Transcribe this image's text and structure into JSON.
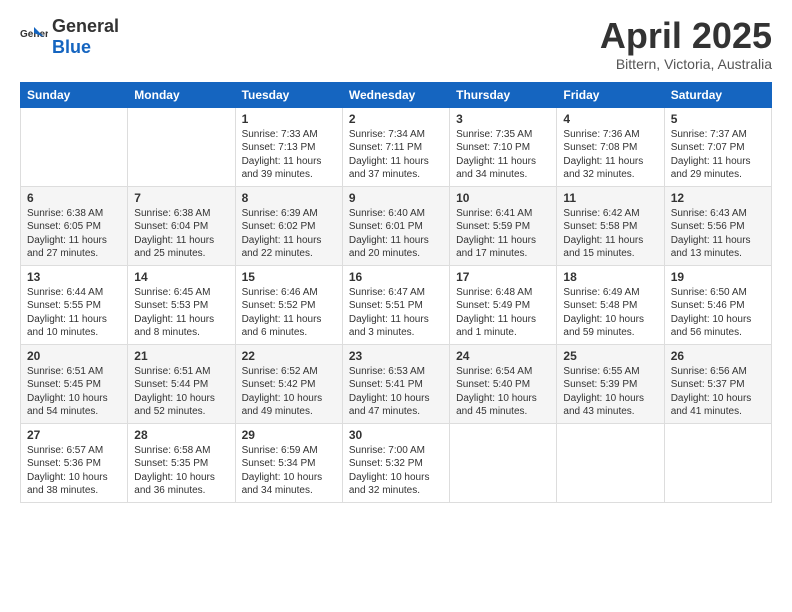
{
  "logo": {
    "general": "General",
    "blue": "Blue"
  },
  "header": {
    "title": "April 2025",
    "subtitle": "Bittern, Victoria, Australia"
  },
  "days_of_week": [
    "Sunday",
    "Monday",
    "Tuesday",
    "Wednesday",
    "Thursday",
    "Friday",
    "Saturday"
  ],
  "weeks": [
    [
      {
        "day": "",
        "info": ""
      },
      {
        "day": "",
        "info": ""
      },
      {
        "day": "1",
        "info": "Sunrise: 7:33 AM\nSunset: 7:13 PM\nDaylight: 11 hours and 39 minutes."
      },
      {
        "day": "2",
        "info": "Sunrise: 7:34 AM\nSunset: 7:11 PM\nDaylight: 11 hours and 37 minutes."
      },
      {
        "day": "3",
        "info": "Sunrise: 7:35 AM\nSunset: 7:10 PM\nDaylight: 11 hours and 34 minutes."
      },
      {
        "day": "4",
        "info": "Sunrise: 7:36 AM\nSunset: 7:08 PM\nDaylight: 11 hours and 32 minutes."
      },
      {
        "day": "5",
        "info": "Sunrise: 7:37 AM\nSunset: 7:07 PM\nDaylight: 11 hours and 29 minutes."
      }
    ],
    [
      {
        "day": "6",
        "info": "Sunrise: 6:38 AM\nSunset: 6:05 PM\nDaylight: 11 hours and 27 minutes."
      },
      {
        "day": "7",
        "info": "Sunrise: 6:38 AM\nSunset: 6:04 PM\nDaylight: 11 hours and 25 minutes."
      },
      {
        "day": "8",
        "info": "Sunrise: 6:39 AM\nSunset: 6:02 PM\nDaylight: 11 hours and 22 minutes."
      },
      {
        "day": "9",
        "info": "Sunrise: 6:40 AM\nSunset: 6:01 PM\nDaylight: 11 hours and 20 minutes."
      },
      {
        "day": "10",
        "info": "Sunrise: 6:41 AM\nSunset: 5:59 PM\nDaylight: 11 hours and 17 minutes."
      },
      {
        "day": "11",
        "info": "Sunrise: 6:42 AM\nSunset: 5:58 PM\nDaylight: 11 hours and 15 minutes."
      },
      {
        "day": "12",
        "info": "Sunrise: 6:43 AM\nSunset: 5:56 PM\nDaylight: 11 hours and 13 minutes."
      }
    ],
    [
      {
        "day": "13",
        "info": "Sunrise: 6:44 AM\nSunset: 5:55 PM\nDaylight: 11 hours and 10 minutes."
      },
      {
        "day": "14",
        "info": "Sunrise: 6:45 AM\nSunset: 5:53 PM\nDaylight: 11 hours and 8 minutes."
      },
      {
        "day": "15",
        "info": "Sunrise: 6:46 AM\nSunset: 5:52 PM\nDaylight: 11 hours and 6 minutes."
      },
      {
        "day": "16",
        "info": "Sunrise: 6:47 AM\nSunset: 5:51 PM\nDaylight: 11 hours and 3 minutes."
      },
      {
        "day": "17",
        "info": "Sunrise: 6:48 AM\nSunset: 5:49 PM\nDaylight: 11 hours and 1 minute."
      },
      {
        "day": "18",
        "info": "Sunrise: 6:49 AM\nSunset: 5:48 PM\nDaylight: 10 hours and 59 minutes."
      },
      {
        "day": "19",
        "info": "Sunrise: 6:50 AM\nSunset: 5:46 PM\nDaylight: 10 hours and 56 minutes."
      }
    ],
    [
      {
        "day": "20",
        "info": "Sunrise: 6:51 AM\nSunset: 5:45 PM\nDaylight: 10 hours and 54 minutes."
      },
      {
        "day": "21",
        "info": "Sunrise: 6:51 AM\nSunset: 5:44 PM\nDaylight: 10 hours and 52 minutes."
      },
      {
        "day": "22",
        "info": "Sunrise: 6:52 AM\nSunset: 5:42 PM\nDaylight: 10 hours and 49 minutes."
      },
      {
        "day": "23",
        "info": "Sunrise: 6:53 AM\nSunset: 5:41 PM\nDaylight: 10 hours and 47 minutes."
      },
      {
        "day": "24",
        "info": "Sunrise: 6:54 AM\nSunset: 5:40 PM\nDaylight: 10 hours and 45 minutes."
      },
      {
        "day": "25",
        "info": "Sunrise: 6:55 AM\nSunset: 5:39 PM\nDaylight: 10 hours and 43 minutes."
      },
      {
        "day": "26",
        "info": "Sunrise: 6:56 AM\nSunset: 5:37 PM\nDaylight: 10 hours and 41 minutes."
      }
    ],
    [
      {
        "day": "27",
        "info": "Sunrise: 6:57 AM\nSunset: 5:36 PM\nDaylight: 10 hours and 38 minutes."
      },
      {
        "day": "28",
        "info": "Sunrise: 6:58 AM\nSunset: 5:35 PM\nDaylight: 10 hours and 36 minutes."
      },
      {
        "day": "29",
        "info": "Sunrise: 6:59 AM\nSunset: 5:34 PM\nDaylight: 10 hours and 34 minutes."
      },
      {
        "day": "30",
        "info": "Sunrise: 7:00 AM\nSunset: 5:32 PM\nDaylight: 10 hours and 32 minutes."
      },
      {
        "day": "",
        "info": ""
      },
      {
        "day": "",
        "info": ""
      },
      {
        "day": "",
        "info": ""
      }
    ]
  ]
}
